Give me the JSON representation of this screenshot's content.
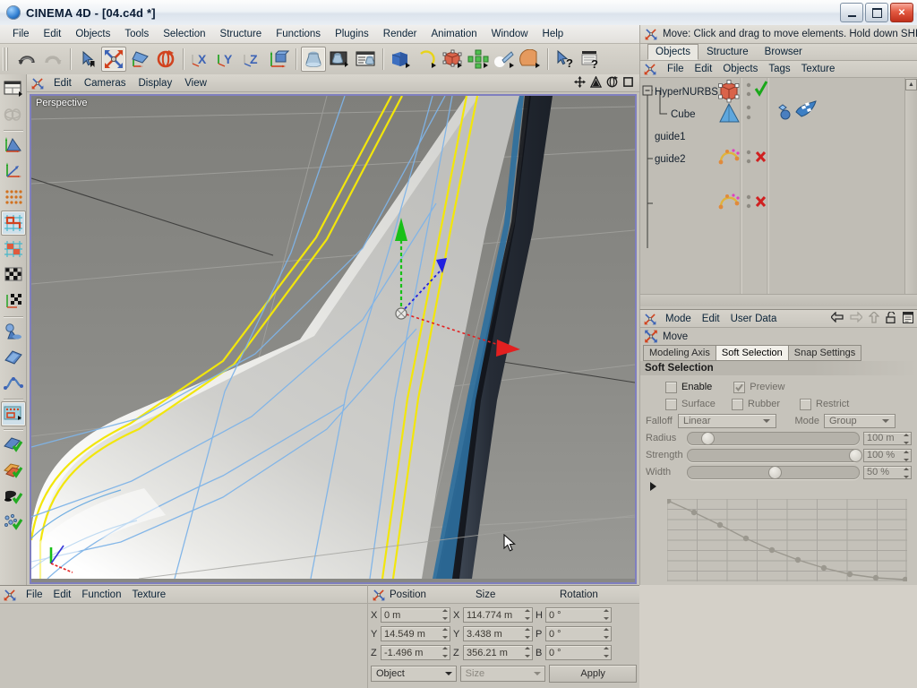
{
  "window": {
    "title": "CINEMA 4D - [04.c4d *]",
    "app_icon": "c4d-sphere-icon",
    "controls": {
      "minimize": "minimize-button",
      "maximize": "maximize-button",
      "close": "close-button"
    }
  },
  "menubar": {
    "items": [
      "File",
      "Edit",
      "Objects",
      "Tools",
      "Selection",
      "Structure",
      "Functions",
      "Plugins",
      "Render",
      "Animation",
      "Window",
      "Help"
    ]
  },
  "toolbar": {
    "groups": [
      {
        "buttons": [
          {
            "name": "undo-icon",
            "label": "Undo",
            "active": false
          },
          {
            "name": "redo-icon",
            "label": "Redo",
            "active": false
          }
        ]
      },
      {
        "buttons": [
          {
            "name": "select-cursor-icon",
            "label": "Live Selection",
            "active": false
          },
          {
            "name": "move-tool-icon",
            "label": "Move",
            "active": true
          },
          {
            "name": "scale-tool-icon",
            "label": "Scale",
            "active": false
          },
          {
            "name": "rotate-tool-icon",
            "label": "Rotate",
            "active": false
          }
        ]
      },
      {
        "buttons": [
          {
            "name": "axis-x-lock-icon",
            "label": "X Axis",
            "active": false
          },
          {
            "name": "axis-y-lock-icon",
            "label": "Y Axis",
            "active": false
          },
          {
            "name": "axis-z-lock-icon",
            "label": "Z Axis",
            "active": false
          },
          {
            "name": "world-object-axis-icon",
            "label": "World / Object",
            "active": false
          }
        ]
      },
      {
        "buttons": [
          {
            "name": "render-view-icon",
            "label": "Render View",
            "active": true
          },
          {
            "name": "render-region-icon",
            "label": "Render Region",
            "active": false
          },
          {
            "name": "render-settings-icon",
            "label": "Render Settings",
            "active": false
          }
        ]
      },
      {
        "buttons": [
          {
            "name": "primitive-cube-icon",
            "label": "Cube",
            "active": false
          },
          {
            "name": "spline-arc-icon",
            "label": "Spline",
            "active": false
          },
          {
            "name": "nurbs-hyper-icon",
            "label": "HyperNURBS",
            "active": false
          },
          {
            "name": "array-modeling-icon",
            "label": "Array",
            "active": false
          },
          {
            "name": "light-icon",
            "label": "Light",
            "active": false
          },
          {
            "name": "camera-scene-icon",
            "label": "Scene",
            "active": false
          }
        ]
      },
      {
        "buttons": [
          {
            "name": "help-cursor-icon",
            "label": "Context Help",
            "active": false
          },
          {
            "name": "help-manual-icon",
            "label": "Help Manual",
            "active": false
          }
        ]
      }
    ]
  },
  "left_palette": {
    "buttons": [
      {
        "name": "layout-presets-icon",
        "label": "Layout",
        "active": false
      },
      {
        "name": "make-editable-icon",
        "label": "Make Editable",
        "active": false
      },
      {
        "name": "model-mode-icon",
        "label": "Model Mode",
        "active": false
      },
      {
        "name": "object-axis-mode-icon",
        "label": "Object Axis",
        "active": false
      },
      {
        "name": "point-mode-icon",
        "label": "Points",
        "active": false
      },
      {
        "name": "edge-mode-icon",
        "label": "Edges",
        "active": true
      },
      {
        "name": "polygon-mode-icon",
        "label": "Polygons",
        "active": false
      },
      {
        "name": "texture-mode-icon",
        "label": "Texture",
        "active": false
      },
      {
        "name": "texture-axis-mode-icon",
        "label": "Texture Axis",
        "active": false
      },
      {
        "name": "deformer-mode-icon",
        "label": "Deformer",
        "active": false
      },
      {
        "name": "workplane-mode-icon",
        "label": "Workplane",
        "active": false
      },
      {
        "name": "animation-mode-icon",
        "label": "Animation",
        "active": false
      },
      {
        "name": "selection-filter-icon",
        "label": "Selection Filter",
        "active": true
      },
      {
        "name": "enable-axis-icon",
        "label": "Enable Axis Modification",
        "active": false
      },
      {
        "name": "quantize-icon",
        "label": "Quantize",
        "active": false
      },
      {
        "name": "viewport-solo-icon",
        "label": "Viewport Solo",
        "active": false
      },
      {
        "name": "snap-enable-icon",
        "label": "Enable Snap",
        "active": false
      }
    ]
  },
  "viewport": {
    "menu": [
      "Edit",
      "Cameras",
      "Display",
      "View"
    ],
    "corner_icons": [
      {
        "name": "pan-view-icon"
      },
      {
        "name": "zoom-view-icon"
      },
      {
        "name": "rotate-view-icon"
      },
      {
        "name": "maximize-view-icon"
      }
    ],
    "label": "Perspective",
    "axis_gizmo": {
      "x_color": "#e32020",
      "y_color": "#18c018",
      "z_color": "#2020e0",
      "x_label": "X",
      "y_label": "Y",
      "z_label": "Z"
    },
    "edge_highlight_color": "#f2e60b",
    "mesh_wire_color": "#7fb4e8"
  },
  "status": {
    "icon": "move-tool-icon",
    "text": "Move: Click and drag to move elements. Hold down SHIFT"
  },
  "object_manager": {
    "tabs": [
      {
        "label": "Objects",
        "selected": true
      },
      {
        "label": "Structure",
        "selected": false
      },
      {
        "label": "Browser",
        "selected": false
      }
    ],
    "menu": [
      "File",
      "Edit",
      "Objects",
      "Tags",
      "Texture"
    ],
    "menu_icon": "move-tool-icon",
    "rows": [
      {
        "name": "HyperNURBS",
        "indent": 0,
        "expander": "minus",
        "icon": "hypernurbs-icon",
        "enabled_mark": "check",
        "tags": [
          "phong-tag-icon",
          "texture-tag-icon"
        ]
      },
      {
        "name": "Cube",
        "indent": 1,
        "expander": "none",
        "icon": "cube-object-icon",
        "enabled_mark": "none",
        "tags": []
      },
      {
        "name": "guide1",
        "indent": 0,
        "expander": "none",
        "icon": "spline-object-icon",
        "enabled_mark": "cross",
        "tags": []
      },
      {
        "name": "guide2",
        "indent": 0,
        "expander": "none",
        "icon": "spline-object-icon",
        "enabled_mark": "cross",
        "tags": []
      }
    ]
  },
  "attribute_manager": {
    "menu": [
      "Mode",
      "Edit",
      "User Data"
    ],
    "menu_icon": "move-tool-icon",
    "nav_icons": [
      "back-arrow-icon",
      "forward-arrow-icon",
      "up-arrow-icon",
      "lock-icon",
      "page-icon"
    ],
    "object_icon": "move-tool-icon",
    "object_title": "Move",
    "tabs": [
      {
        "label": "Modeling Axis",
        "selected": false
      },
      {
        "label": "Soft Selection",
        "selected": true
      },
      {
        "label": "Snap Settings",
        "selected": false
      }
    ],
    "group_title": "Soft Selection",
    "checkboxes_row1": [
      {
        "label": "Enable",
        "checked": false,
        "dim": false
      },
      {
        "label": "Preview",
        "checked": true,
        "dim": true
      }
    ],
    "checkboxes_row2": [
      {
        "label": "Surface",
        "checked": false,
        "dim": true
      },
      {
        "label": "Rubber",
        "checked": false,
        "dim": true
      },
      {
        "label": "Restrict",
        "checked": false,
        "dim": true
      }
    ],
    "falloff": {
      "label": "Falloff",
      "value": "Linear"
    },
    "mode": {
      "label": "Mode",
      "value": "Group"
    },
    "sliders": [
      {
        "label": "Radius",
        "value": "100 m",
        "percent": 8
      },
      {
        "label": "Strength",
        "value": "100 %",
        "percent": 97
      },
      {
        "label": "Width",
        "value": "50 %",
        "percent": 50
      }
    ],
    "curve": {
      "expander": "triangle-right-icon",
      "points": [
        [
          0,
          0
        ],
        [
          0.11,
          0.16
        ],
        [
          0.22,
          0.29
        ],
        [
          0.33,
          0.45
        ],
        [
          0.44,
          0.6
        ],
        [
          0.55,
          0.72
        ],
        [
          0.66,
          0.82
        ],
        [
          0.77,
          0.9
        ],
        [
          0.88,
          0.96
        ],
        [
          1,
          1
        ]
      ],
      "grid_cols": 8,
      "grid_rows": 8
    }
  },
  "material_manager": {
    "menu": [
      "File",
      "Edit",
      "Function",
      "Texture"
    ],
    "menu_icon": "move-tool-icon",
    "materials": []
  },
  "coordinates": {
    "icon": "move-tool-icon",
    "headers": [
      "Position",
      "Size",
      "Rotation"
    ],
    "rows": [
      {
        "pos_axis": "X",
        "pos_value": "0 m",
        "size_axis": "X",
        "size_value": "114.774 m",
        "rot_axis": "H",
        "rot_value": "0 °"
      },
      {
        "pos_axis": "Y",
        "pos_value": "14.549 m",
        "size_axis": "Y",
        "size_value": "3.438 m",
        "rot_axis": "P",
        "rot_value": "0 °"
      },
      {
        "pos_axis": "Z",
        "pos_value": "-1.496 m",
        "size_axis": "Z",
        "size_value": "356.21 m",
        "rot_axis": "B",
        "rot_value": "0 °"
      }
    ],
    "coord_system": "Object",
    "size_mode": "Size",
    "apply_label": "Apply"
  },
  "colors": {
    "panel_bg": "#c6c3bb",
    "panel_light": "#d6d3cb",
    "viewport_bg": "#888884",
    "viewport_border": "#7f7fbf",
    "highlight_yellow": "#f2e60b",
    "wire_blue": "#7fb4e8",
    "accent_red": "#e32020",
    "accent_green": "#18c018",
    "accent_blue": "#2020e0"
  }
}
